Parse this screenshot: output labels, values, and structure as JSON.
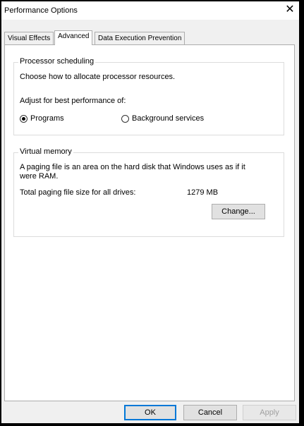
{
  "window": {
    "title": "Performance Options",
    "close_glyph": "✕"
  },
  "tabs": [
    {
      "label": "Visual Effects",
      "active": false
    },
    {
      "label": "Advanced",
      "active": true
    },
    {
      "label": "Data Execution Prevention",
      "active": false
    }
  ],
  "processor": {
    "title": "Processor scheduling",
    "description": "Choose how to allocate processor resources.",
    "adjust_label": "Adjust for best performance of:",
    "options": [
      {
        "label": "Programs",
        "selected": true
      },
      {
        "label": "Background services",
        "selected": false
      }
    ]
  },
  "virtual_memory": {
    "title": "Virtual memory",
    "description_line1": "A paging file is an area on the hard disk that Windows uses as if it",
    "description_line2": "were RAM.",
    "total_label": "Total paging file size for all drives:",
    "total_value": "1279 MB",
    "change_label": "Change..."
  },
  "footer": {
    "ok_label": "OK",
    "cancel_label": "Cancel",
    "apply_label": "Apply"
  }
}
